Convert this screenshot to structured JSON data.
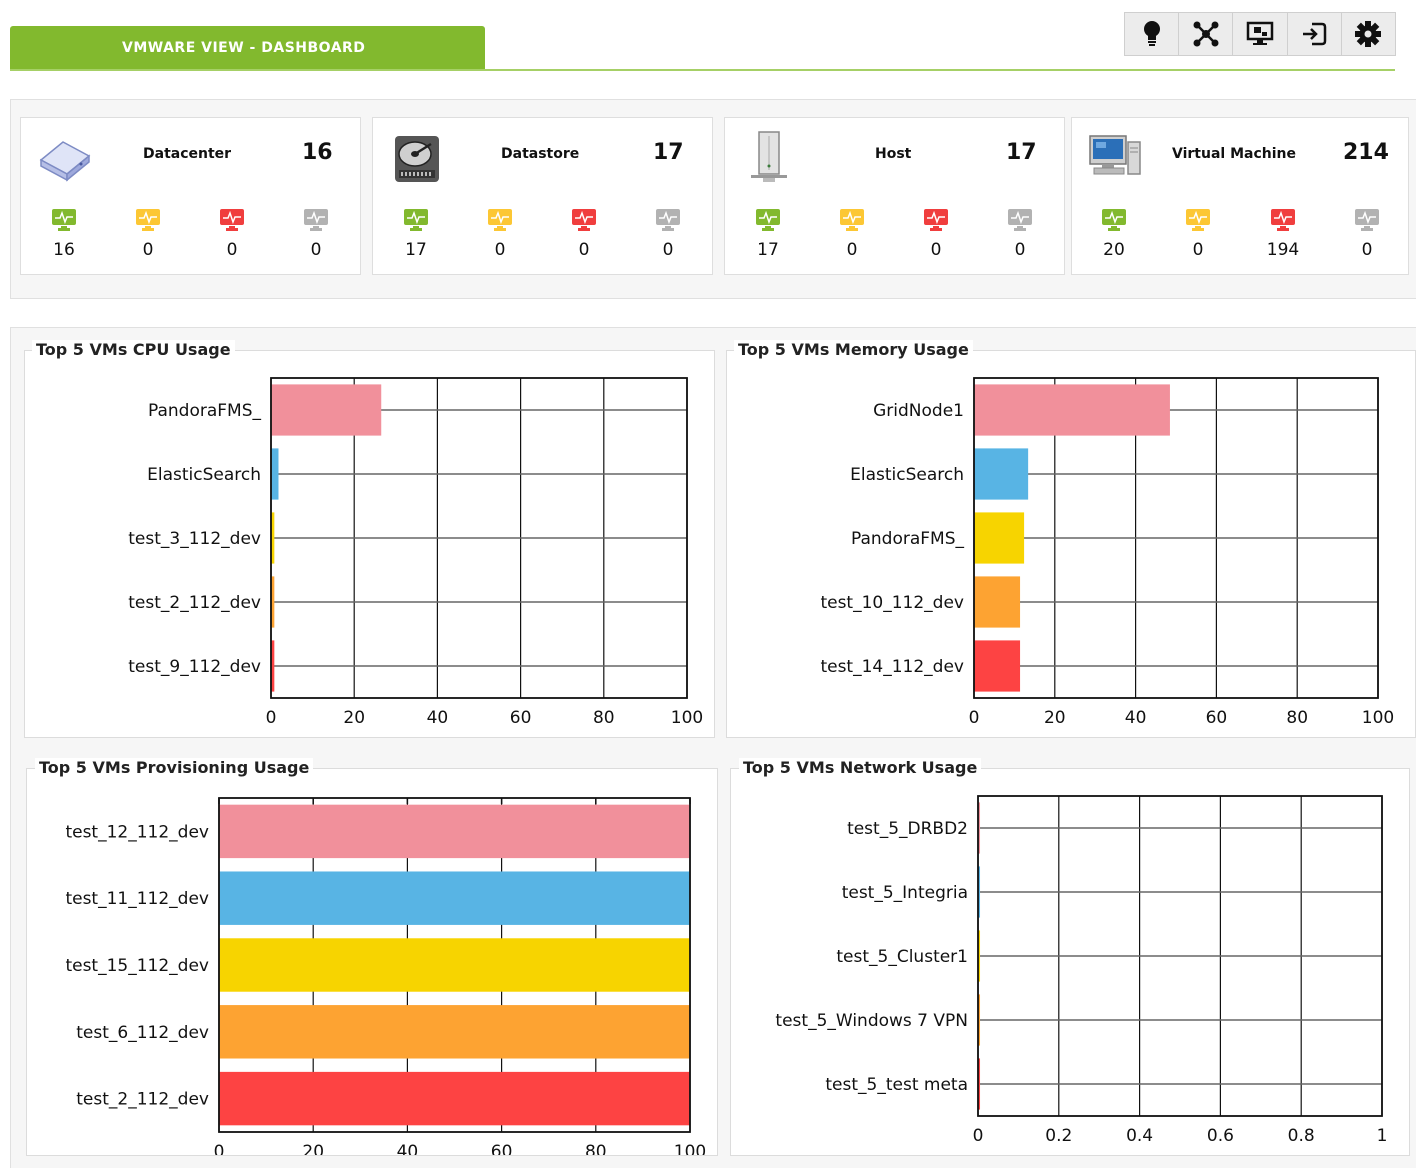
{
  "header": {
    "tab_title": "VMWARE VIEW - DASHBOARD"
  },
  "toolbar": {
    "icons": [
      "lightbulb-icon",
      "network-map-icon",
      "vm-monitor-icon",
      "login-icon",
      "gear-icon"
    ]
  },
  "status_colors": {
    "ok": "#82b92e",
    "warning": "#fcc734",
    "critical": "#f03e3e",
    "unknown": "#b2b2b2"
  },
  "summary": [
    {
      "title": "Datacenter",
      "total": "16",
      "icon": "datacenter-icon",
      "counts": [
        "16",
        "0",
        "0",
        "0"
      ]
    },
    {
      "title": "Datastore",
      "total": "17",
      "icon": "datastore-icon",
      "counts": [
        "17",
        "0",
        "0",
        "0"
      ]
    },
    {
      "title": "Host",
      "total": "17",
      "icon": "host-icon",
      "counts": [
        "17",
        "0",
        "0",
        "0"
      ]
    },
    {
      "title": "Virtual Machine",
      "total": "214",
      "icon": "virtual-machine-icon",
      "counts": [
        "20",
        "0",
        "194",
        "0"
      ]
    }
  ],
  "bar_colors": [
    "#f1909b",
    "#58b4e4",
    "#f7d400",
    "#fda332",
    "#fd4343"
  ],
  "chart_data": [
    {
      "type": "bar",
      "orientation": "horizontal",
      "title": "Top 5 VMs CPU Usage",
      "categories": [
        "PandoraFMS_",
        "ElasticSearch",
        "test_3_112_dev",
        "test_2_112_dev",
        "test_9_112_dev"
      ],
      "values": [
        26.5,
        1.8,
        0.8,
        0.8,
        0.8
      ],
      "xlim": [
        0,
        100
      ],
      "xticks": [
        "0",
        "20",
        "40",
        "60",
        "80",
        "100"
      ],
      "grid": true
    },
    {
      "type": "bar",
      "orientation": "horizontal",
      "title": "Top 5 VMs Memory Usage",
      "categories": [
        "GridNode1",
        "ElasticSearch",
        "PandoraFMS_",
        "test_10_112_dev",
        "test_14_112_dev"
      ],
      "values": [
        48.5,
        13.4,
        12.4,
        11.4,
        11.4
      ],
      "xlim": [
        0,
        100
      ],
      "xticks": [
        "0",
        "20",
        "40",
        "60",
        "80",
        "100"
      ],
      "grid": true
    },
    {
      "type": "bar",
      "orientation": "horizontal",
      "title": "Top 5 VMs Provisioning Usage",
      "categories": [
        "test_12_112_dev",
        "test_11_112_dev",
        "test_15_112_dev",
        "test_6_112_dev",
        "test_2_112_dev"
      ],
      "values": [
        100,
        100,
        100,
        100,
        100
      ],
      "xlim": [
        0,
        100
      ],
      "xticks": [
        "0",
        "20",
        "40",
        "60",
        "80",
        "100"
      ],
      "grid": true
    },
    {
      "type": "bar",
      "orientation": "horizontal",
      "title": "Top 5 VMs Network Usage",
      "categories": [
        "test_5_DRBD2",
        "test_5_Integria",
        "test_5_Cluster1",
        "test_5_Windows 7 VPN",
        "test_5_test meta"
      ],
      "values": [
        0.005,
        0.005,
        0.005,
        0.005,
        0.005
      ],
      "xlim": [
        0,
        1
      ],
      "xticks": [
        "0",
        "0.2",
        "0.4",
        "0.6",
        "0.8",
        "1"
      ],
      "grid": true
    }
  ]
}
